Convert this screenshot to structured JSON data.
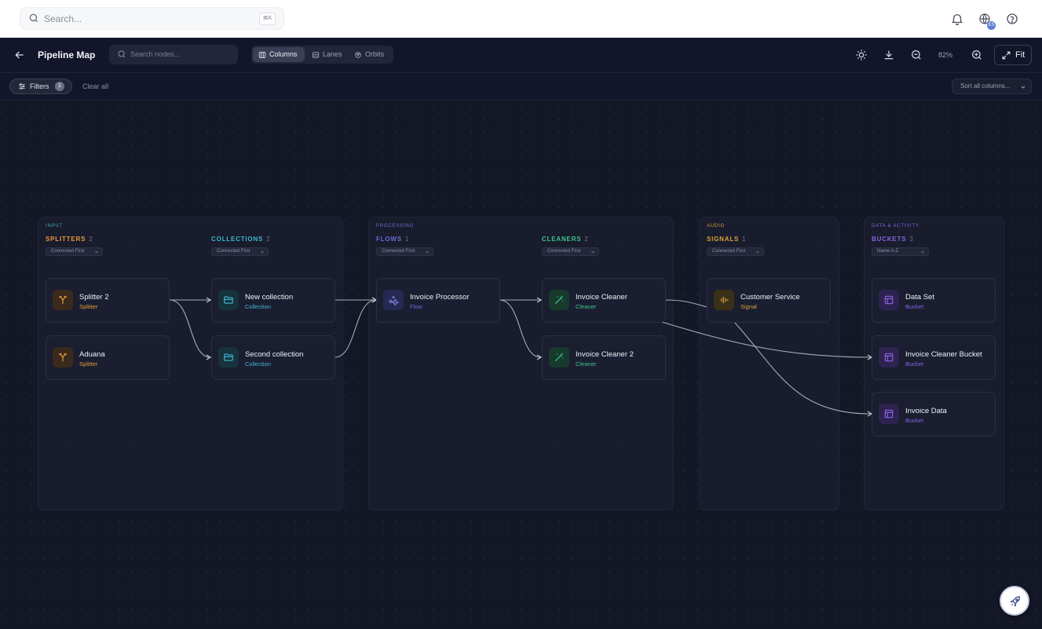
{
  "topbar": {
    "search_placeholder": "Search...",
    "search_shortcut": "⌘K",
    "notifications_icon": "bell-icon",
    "language_icon": "globe-icon",
    "language_badge": "ES",
    "help_icon": "help-circle-icon"
  },
  "header": {
    "back_icon": "arrow-left-icon",
    "title": "Pipeline Map",
    "search_placeholder": "Search nodes...",
    "view_modes": [
      {
        "label": "Columns",
        "icon": "columns-icon",
        "active": true
      },
      {
        "label": "Lanes",
        "icon": "lanes-icon",
        "active": false
      },
      {
        "label": "Orbits",
        "icon": "orbit-icon",
        "active": false
      }
    ],
    "zoom": "82%",
    "fit_label": "Fit"
  },
  "filterbar": {
    "filters_label": "Filters",
    "filters_count": "1",
    "clear_label": "Clear all",
    "sort_label": "Sort all columns..."
  },
  "groups": [
    {
      "label": "INPUT",
      "color": "#3fa8b8"
    },
    {
      "label": "PROCESSING",
      "color": "#6b6fd6"
    },
    {
      "label": "AUDIO",
      "color": "#d7a23b"
    },
    {
      "label": "DATA & ACTIVITY",
      "color": "#8a63e6"
    }
  ],
  "columns": [
    {
      "title": "SPLITTERS",
      "count": "2",
      "color": "#e89a3c",
      "sort": "Connected First",
      "nodes": [
        {
          "name": "Splitter 2",
          "type": "Splitter",
          "icon": "split-icon"
        },
        {
          "name": "Aduana",
          "type": "Splitter",
          "icon": "split-icon"
        }
      ]
    },
    {
      "title": "COLLECTIONS",
      "count": "2",
      "color": "#3fb8d0",
      "sort": "Connected First",
      "nodes": [
        {
          "name": "New collection",
          "type": "Collection",
          "icon": "folder-icon"
        },
        {
          "name": "Second collection",
          "type": "Collection",
          "icon": "folder-icon"
        }
      ]
    },
    {
      "title": "FLOWS",
      "count": "1",
      "color": "#6b6fd6",
      "sort": "Connected First",
      "nodes": [
        {
          "name": "Invoice Processor",
          "type": "Flow",
          "icon": "sparkles-icon"
        }
      ]
    },
    {
      "title": "CLEANERS",
      "count": "2",
      "color": "#3fc48a",
      "sort": "Connected First",
      "nodes": [
        {
          "name": "Invoice Cleaner",
          "type": "Cleaner",
          "icon": "wand-icon"
        },
        {
          "name": "Invoice Cleaner 2",
          "type": "Cleaner",
          "icon": "wand-icon"
        }
      ]
    },
    {
      "title": "SIGNALS",
      "count": "1",
      "color": "#d7a23b",
      "sort": "Connected First",
      "nodes": [
        {
          "name": "Customer Service",
          "type": "Signal",
          "icon": "audio-wave-icon"
        }
      ]
    },
    {
      "title": "BUCKETS",
      "count": "3",
      "color": "#8a63e6",
      "sort": "Name A-Z",
      "nodes": [
        {
          "name": "Data Set",
          "type": "Bucket",
          "icon": "table-icon"
        },
        {
          "name": "Invoice Cleaner Bucket",
          "type": "Bucket",
          "icon": "table-icon"
        },
        {
          "name": "Invoice Data",
          "type": "Bucket",
          "icon": "table-icon"
        }
      ]
    }
  ],
  "fab_icon": "rocket-icon"
}
